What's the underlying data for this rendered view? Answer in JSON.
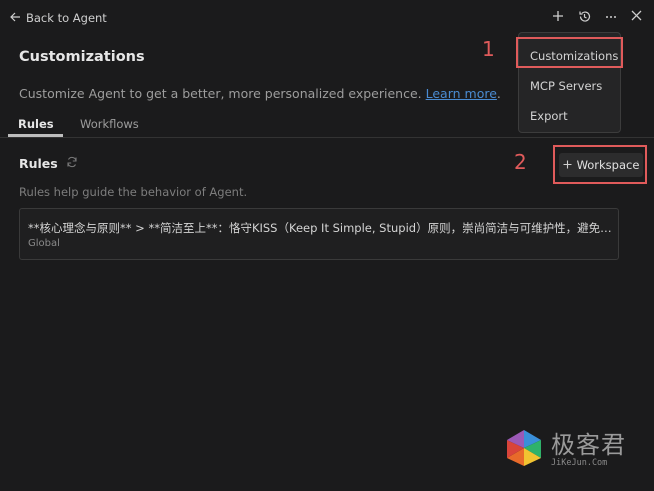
{
  "topbar": {
    "back_label": "Back to Agent",
    "icons": [
      "add-icon",
      "history-icon",
      "more-icon",
      "close-icon"
    ]
  },
  "page": {
    "title": "Customizations",
    "subtitle": "Customize Agent to get a better, more personalized experience.",
    "learn_more": "Learn more",
    "subtitle_end": "."
  },
  "tabs": [
    {
      "label": "Rules",
      "active": true
    },
    {
      "label": "Workflows",
      "active": false
    }
  ],
  "rules_section": {
    "title": "Rules",
    "description": "Rules help guide the behavior of Agent.",
    "add_button_label": "Workspace"
  },
  "rules": [
    {
      "text": "**核心理念与原则** > **简洁至上**：恪守KISS（Keep It Simple, Stupid）原则，崇尚简洁与可维护性，避免过度…",
      "scope": "Global"
    }
  ],
  "dropdown": {
    "items": [
      "Customizations",
      "MCP Servers",
      "Export"
    ]
  },
  "annotations": {
    "first": "1",
    "second": "2"
  },
  "watermark": {
    "title": "极客君",
    "subtitle": "JiKeJun.Com"
  },
  "colors": {
    "background": "#1b1b1c",
    "highlight": "#e05b5b",
    "link": "#4a8bd1"
  }
}
